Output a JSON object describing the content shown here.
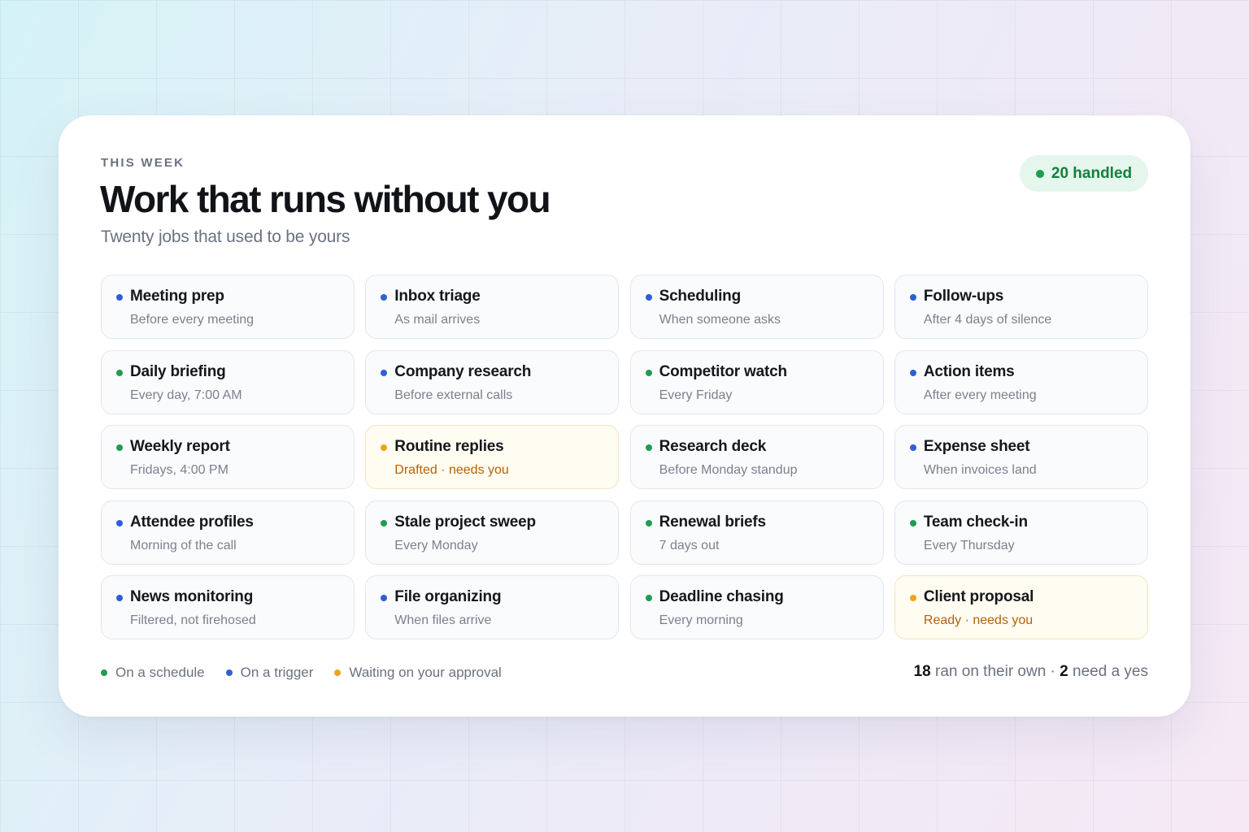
{
  "colors": {
    "schedule": "#1f9d4e",
    "trigger": "#2f5fd6",
    "approval": "#f0a31a",
    "badge_bg": "#e5f6ec",
    "badge_text": "#13803f"
  },
  "header": {
    "eyebrow": "THIS WEEK",
    "title": "Work that runs without you",
    "subtitle": "Twenty jobs that used to be yours",
    "badge": "20 handled"
  },
  "tiles": [
    {
      "name": "Meeting prep",
      "sub": "Before every meeting",
      "status": "trigger"
    },
    {
      "name": "Inbox triage",
      "sub": "As mail arrives",
      "status": "trigger"
    },
    {
      "name": "Scheduling",
      "sub": "When someone asks",
      "status": "trigger"
    },
    {
      "name": "Follow-ups",
      "sub": "After 4 days of silence",
      "status": "trigger"
    },
    {
      "name": "Daily briefing",
      "sub": "Every day, 7:00 AM",
      "status": "schedule"
    },
    {
      "name": "Company research",
      "sub": "Before external calls",
      "status": "trigger"
    },
    {
      "name": "Competitor watch",
      "sub": "Every Friday",
      "status": "schedule"
    },
    {
      "name": "Action items",
      "sub": "After every meeting",
      "status": "trigger"
    },
    {
      "name": "Weekly report",
      "sub": "Fridays, 4:00 PM",
      "status": "schedule"
    },
    {
      "name": "Routine replies",
      "sub": "Drafted · needs you",
      "status": "approval"
    },
    {
      "name": "Research deck",
      "sub": "Before Monday standup",
      "status": "schedule"
    },
    {
      "name": "Expense sheet",
      "sub": "When invoices land",
      "status": "trigger"
    },
    {
      "name": "Attendee profiles",
      "sub": "Morning of the call",
      "status": "trigger"
    },
    {
      "name": "Stale project sweep",
      "sub": "Every Monday",
      "status": "schedule"
    },
    {
      "name": "Renewal briefs",
      "sub": "7 days out",
      "status": "schedule"
    },
    {
      "name": "Team check-in",
      "sub": "Every Thursday",
      "status": "schedule"
    },
    {
      "name": "News monitoring",
      "sub": "Filtered, not firehosed",
      "status": "trigger"
    },
    {
      "name": "File organizing",
      "sub": "When files arrive",
      "status": "trigger"
    },
    {
      "name": "Deadline chasing",
      "sub": "Every morning",
      "status": "schedule"
    },
    {
      "name": "Client proposal",
      "sub": "Ready · needs you",
      "status": "approval"
    }
  ],
  "legend": {
    "schedule": "On a schedule",
    "trigger": "On a trigger",
    "approval": "Waiting on your approval"
  },
  "summary": {
    "ran_count": "18",
    "ran_text": " ran on their own · ",
    "need_count": "2",
    "need_text": " need a yes"
  }
}
